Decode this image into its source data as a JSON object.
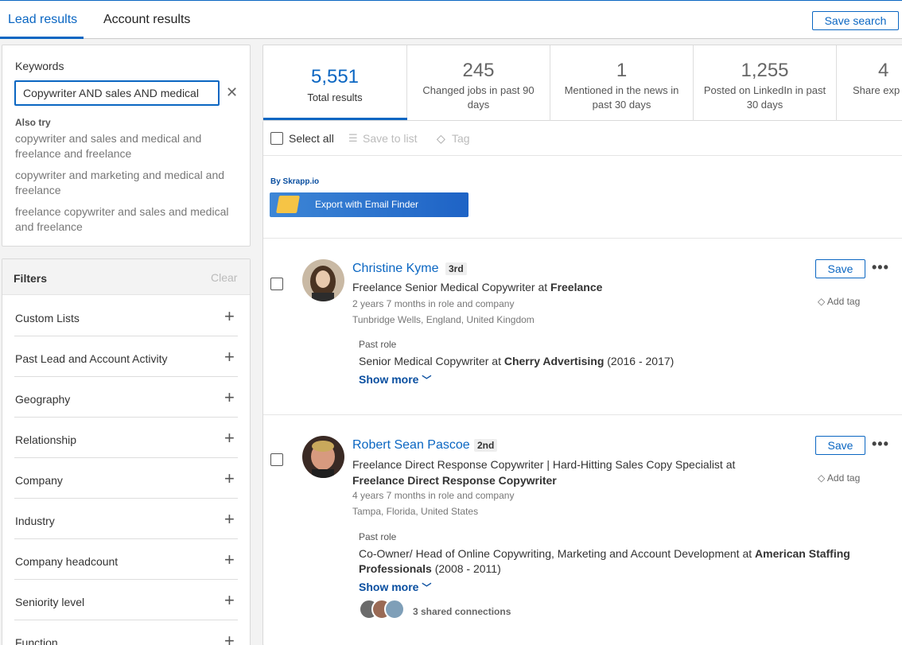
{
  "tabs": {
    "lead": "Lead results",
    "account": "Account results",
    "save_search": "Save search"
  },
  "keywords": {
    "title": "Keywords",
    "value": "Copywriter AND sales AND medical",
    "also_try": "Also try",
    "suggestions": [
      "copywriter and sales and medical and freelance and freelance",
      "copywriter and marketing and medical and freelance",
      "freelance copywriter and sales and medical and freelance"
    ]
  },
  "filters": {
    "title": "Filters",
    "clear": "Clear",
    "items": [
      "Custom Lists",
      "Past Lead and Account Activity",
      "Geography",
      "Relationship",
      "Company",
      "Industry",
      "Company headcount",
      "Seniority level",
      "Function"
    ]
  },
  "stats": [
    {
      "num": "5,551",
      "label": "Total results"
    },
    {
      "num": "245",
      "label": "Changed jobs in past 90 days"
    },
    {
      "num": "1",
      "label": "Mentioned in the news in past 30 days"
    },
    {
      "num": "1,255",
      "label": "Posted on LinkedIn in past 30 days"
    },
    {
      "num": "4",
      "label": "Share exp"
    }
  ],
  "toolbar": {
    "select_all": "Select all",
    "save_to_list": "Save to list",
    "tag": "Tag"
  },
  "skrapp": {
    "by": "By Skrapp.io",
    "button": "Export with Email Finder"
  },
  "leads": [
    {
      "name": "Christine Kyme",
      "degree": "3rd",
      "title_role": "Freelance Senior Medical Copywriter",
      "title_at": "at",
      "title_company": "Freelance",
      "tenure": "2 years 7 months in role and company",
      "location": "Tunbridge Wells, England, United Kingdom",
      "past_role_head": "Past role",
      "past_role_text": "Senior Medical Copywriter at",
      "past_role_company": "Cherry Advertising",
      "past_role_years": " (2016 - 2017)",
      "show_more": "Show more",
      "save": "Save",
      "add_tag": "Add tag"
    },
    {
      "name": "Robert Sean Pascoe",
      "degree": "2nd",
      "title_role": "Freelance Direct Response Copywriter | Hard-Hitting Sales Copy Specialist",
      "title_at": "at",
      "title_company": "Freelance Direct Response Copywriter",
      "tenure": "4 years 7 months in role and company",
      "location": "Tampa, Florida, United States",
      "past_role_head": "Past role",
      "past_role_text": "Co-Owner/ Head of Online Copywriting, Marketing and Account Development at",
      "past_role_company": "American Staffing Professionals",
      "past_role_years": "(2008 - 2011)",
      "show_more": "Show more",
      "save": "Save",
      "add_tag": "Add tag",
      "shared": "3 shared connections"
    }
  ]
}
